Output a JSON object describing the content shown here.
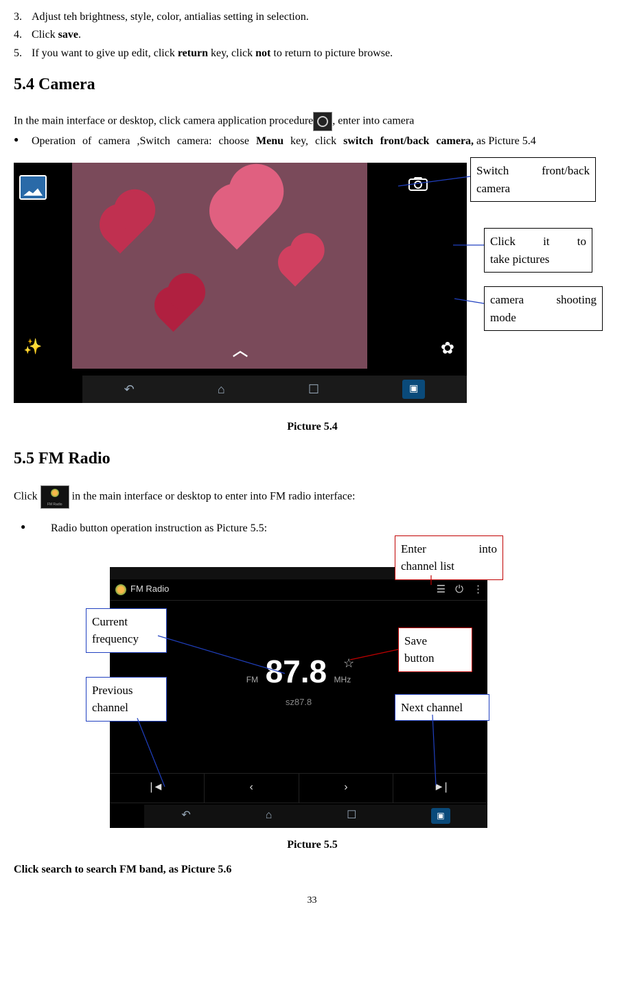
{
  "steps": {
    "s3_num": "3.",
    "s3_text_a": "Adjust teh brightness, style, color, antialias setting in selection.",
    "s4_num": "4.",
    "s4_text_a": "Click ",
    "s4_bold": "save",
    "s4_text_b": ".",
    "s5_num": "5.",
    "s5_text_a": "If you want to give up edit, click ",
    "s5_bold1": "return",
    "s5_text_b": " key, click ",
    "s5_bold2": "not",
    "s5_text_c": " to return to picture browse."
  },
  "section54": {
    "heading": "5.4 Camera",
    "intro_a": "In the main interface or desktop, click camera application procedure",
    "intro_b": ",  enter into camera",
    "op_a": "Operation of camera ,Switch camera: choose ",
    "op_menu": "Menu",
    "op_b": " key, click ",
    "op_switch": "switch front/back camera,",
    "op_c": " as Picture 5.4",
    "callout_switch": "Switch front/back camera",
    "callout_shutter": "Click it to take pictures",
    "callout_mode": "camera shooting mode",
    "caption": "Picture 5.4"
  },
  "section55": {
    "heading": "5.5 FM Radio",
    "intro_a": "Click ",
    "intro_b": " in the main interface or desktop to enter into FM radio interface:",
    "bullet": "Radio button operation instruction as Picture 5.5:",
    "callout_enter": "Enter into channel list",
    "callout_curr": "Current frequency",
    "callout_save": "Save button",
    "callout_prev": "Previous channel",
    "callout_next": "Next channel",
    "caption": "Picture 5.5",
    "search": "Click search to search FM band, as Picture 5.6"
  },
  "fm_ui": {
    "title": "FM Radio",
    "band": "FM",
    "freq": "87.8",
    "unit": "MHz",
    "preset": "sz87.8"
  },
  "page_number": "33"
}
